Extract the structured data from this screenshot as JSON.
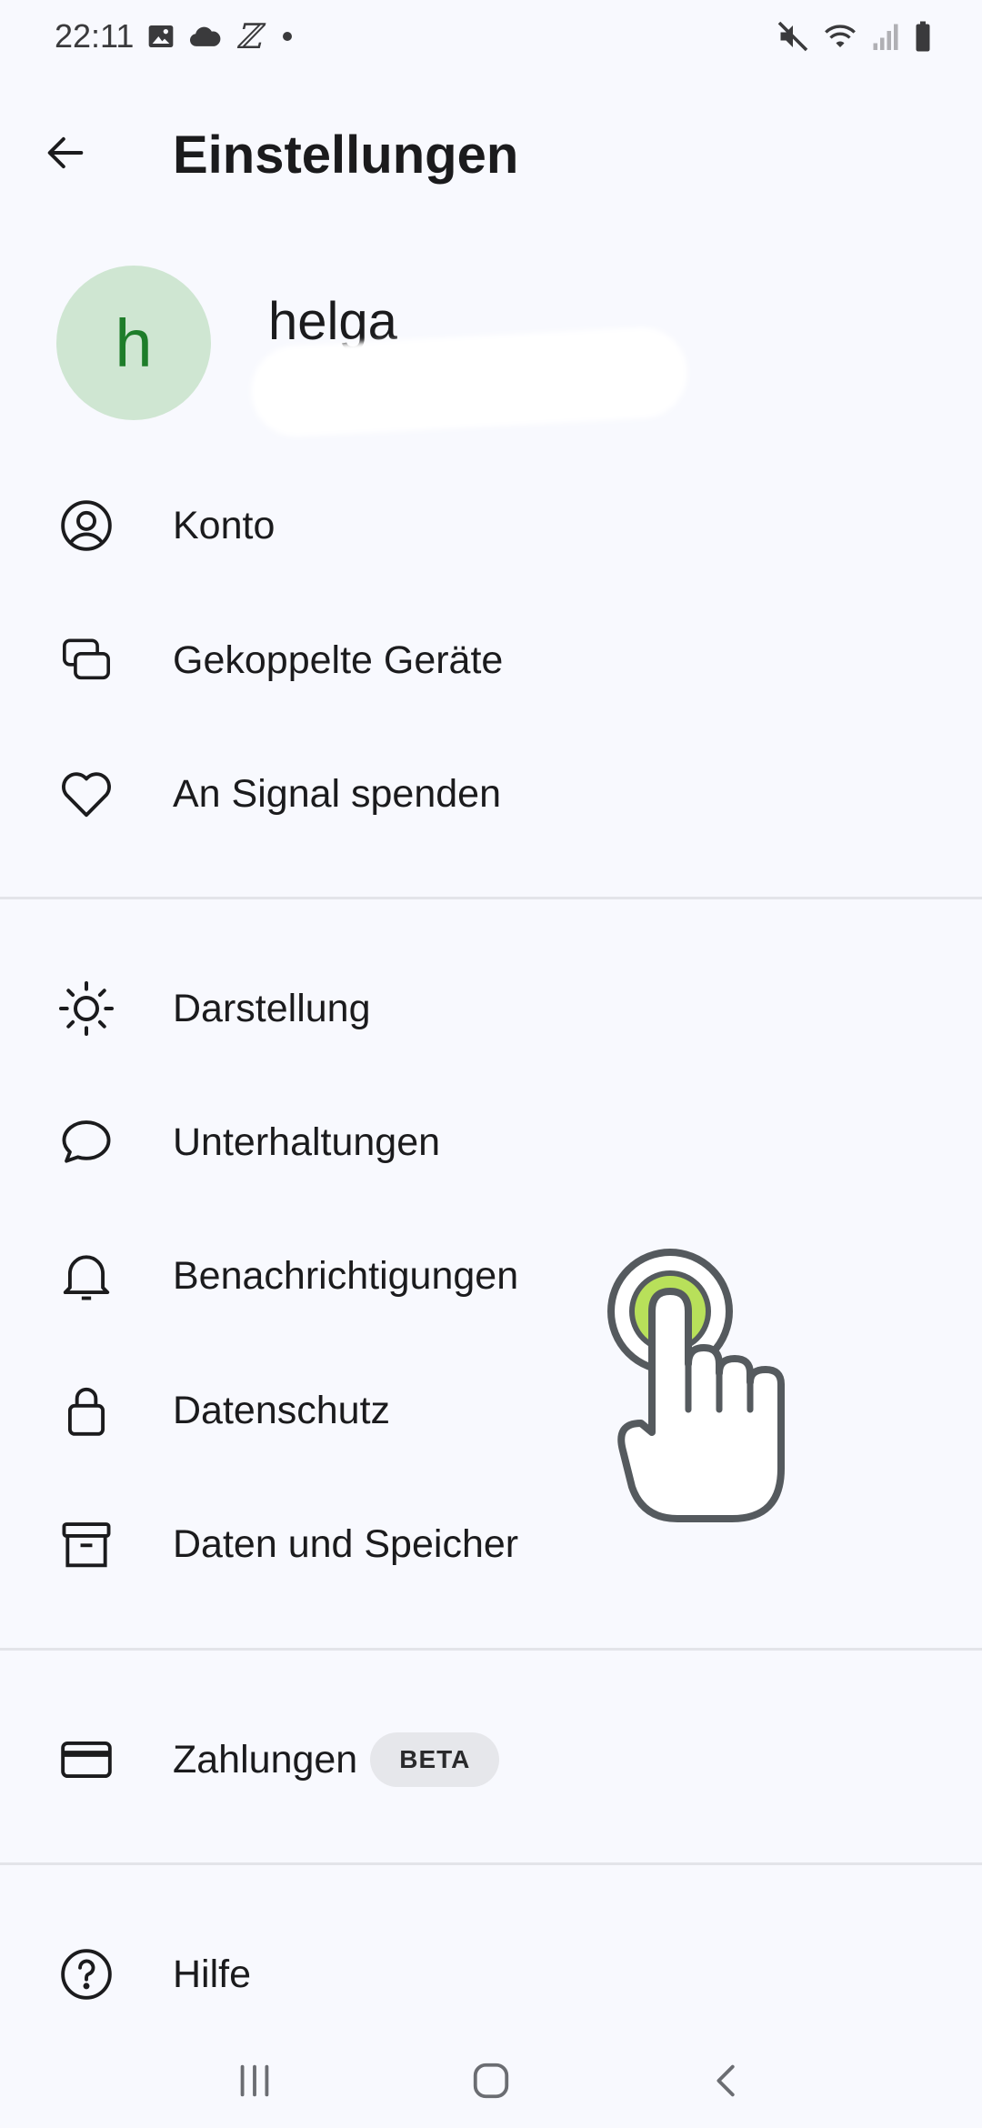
{
  "status_bar": {
    "time": "22:11",
    "left_icons": [
      "image-icon",
      "cloud-icon",
      "z-app-icon",
      "notification-dot"
    ],
    "z_glyph": "ℤ",
    "right_icons": [
      "mute-icon",
      "wifi-icon",
      "signal-icon",
      "battery-icon"
    ]
  },
  "toolbar": {
    "back_icon": "arrow-left-icon",
    "title": "Einstellungen"
  },
  "profile": {
    "avatar_letter": "h",
    "avatar_color": "#cfe6d2",
    "avatar_letter_color": "#1e7d2a",
    "name": "helga"
  },
  "menu": {
    "group1": [
      {
        "label": "Konto",
        "icon": "account-icon"
      },
      {
        "label": "Gekoppelte Geräte",
        "icon": "linked-devices-icon"
      },
      {
        "label": "An Signal spenden",
        "icon": "heart-icon"
      }
    ],
    "group2": [
      {
        "label": "Darstellung",
        "icon": "sun-icon"
      },
      {
        "label": "Unterhaltungen",
        "icon": "chat-bubble-icon"
      },
      {
        "label": "Benachrichtigungen",
        "icon": "bell-icon"
      },
      {
        "label": "Datenschutz",
        "icon": "lock-icon"
      },
      {
        "label": "Daten und Speicher",
        "icon": "archive-icon"
      }
    ],
    "group3": [
      {
        "label": "Zahlungen",
        "icon": "card-icon",
        "badge": "BETA"
      }
    ],
    "group4": [
      {
        "label": "Hilfe",
        "icon": "help-icon"
      }
    ]
  },
  "tap_indicator": {
    "icon": "tap-hand-icon",
    "accent": "#b8e05a"
  },
  "nav_bar": {
    "buttons": [
      "recent-apps-icon",
      "home-icon",
      "back-icon"
    ]
  }
}
